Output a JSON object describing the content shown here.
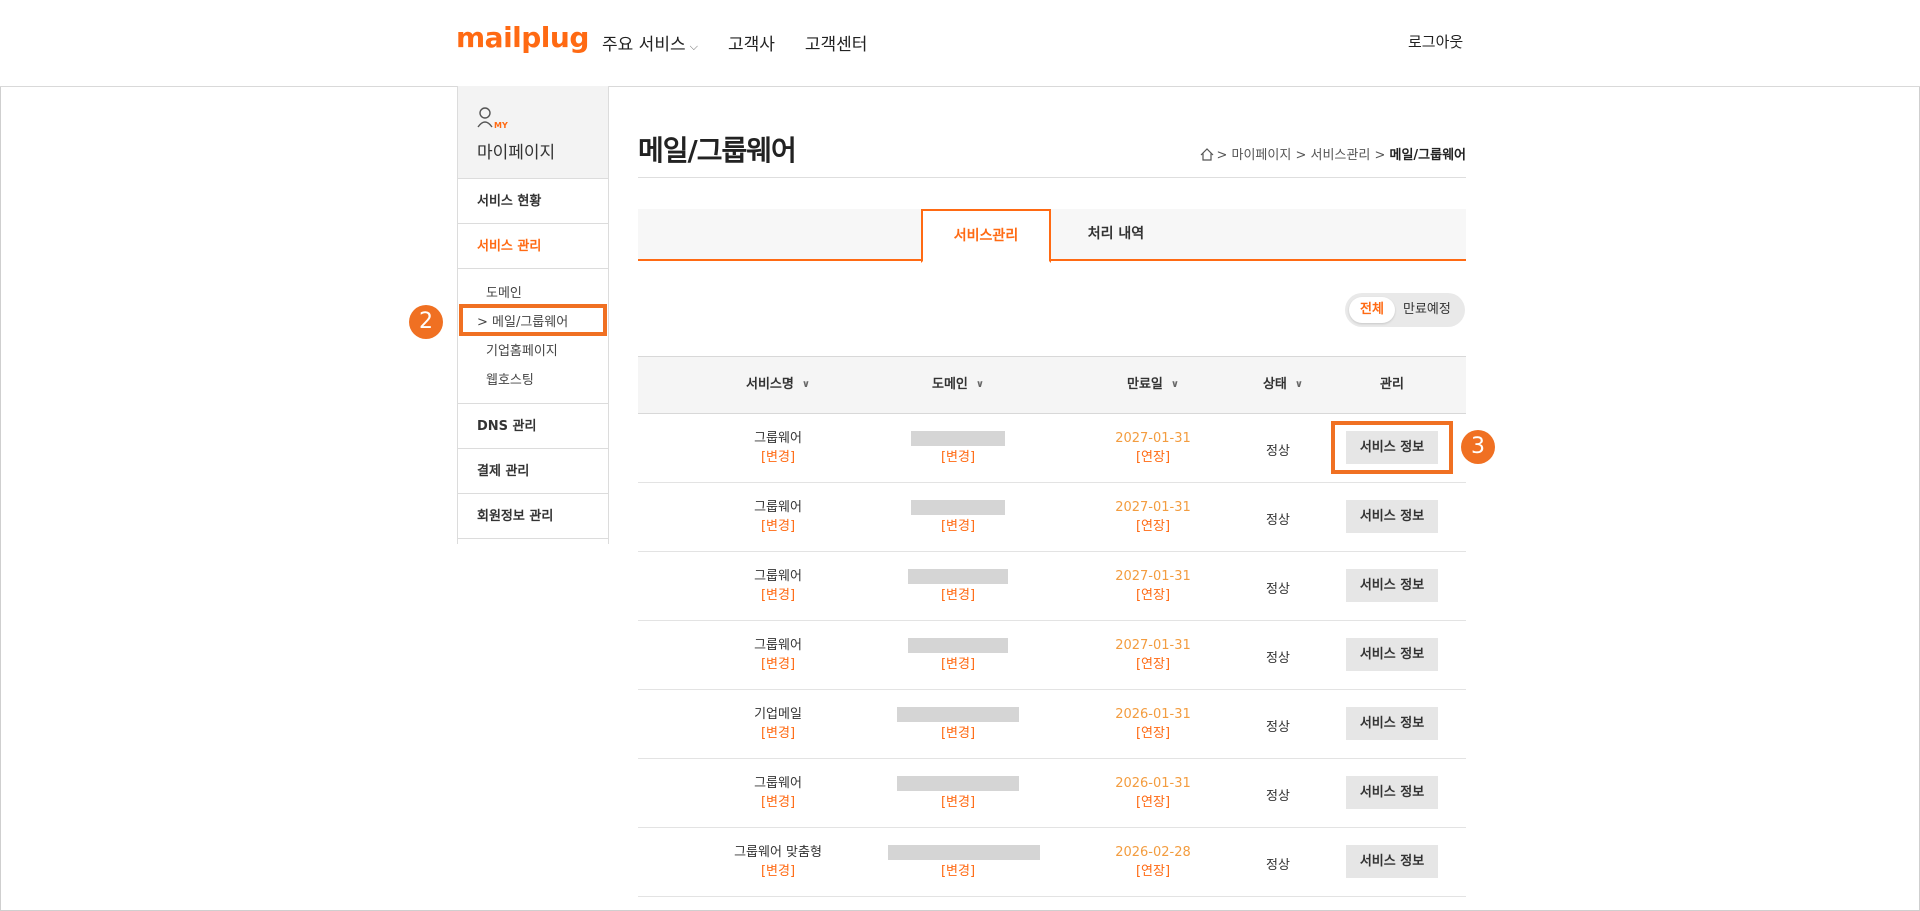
{
  "header": {
    "logo": "mailplug",
    "nav": [
      "주요 서비스",
      "고객사",
      "고객센터"
    ],
    "logout": "로그아웃"
  },
  "sidebar": {
    "my_badge": "MY",
    "title": "마이페이지",
    "items": {
      "service_status": "서비스 현황",
      "service_manage": "서비스 관리",
      "sub": [
        "도메인",
        "메일/그룹웨어",
        "기업홈페이지",
        "웹호스팅"
      ],
      "current_prefix": ">",
      "dns": "DNS 관리",
      "payment": "결제 관리",
      "member": "회원정보 관리"
    }
  },
  "markers": [
    "2",
    "3"
  ],
  "main": {
    "title": "메일/그룹웨어",
    "breadcrumb": [
      ">",
      "마이페이지",
      ">",
      "서비스관리",
      ">",
      "메일/그룹웨어"
    ],
    "tabs": [
      "서비스관리",
      "처리 내역"
    ],
    "filter": {
      "all": "전체",
      "expiring": "만료예정"
    },
    "columns": [
      "서비스명",
      "도메인",
      "만료일",
      "상태",
      "관리"
    ],
    "rows": [
      {
        "service": "그룹웨어",
        "change": "[변경]",
        "domain_change": "[변경]",
        "expiry": "2027-01-31",
        "extend": "[연장]",
        "status": "정상",
        "action": "서비스 정보"
      },
      {
        "service": "그룹웨어",
        "change": "[변경]",
        "domain_change": "[변경]",
        "expiry": "2027-01-31",
        "extend": "[연장]",
        "status": "정상",
        "action": "서비스 정보"
      },
      {
        "service": "그룹웨어",
        "change": "[변경]",
        "domain_change": "[변경]",
        "expiry": "2027-01-31",
        "extend": "[연장]",
        "status": "정상",
        "action": "서비스 정보"
      },
      {
        "service": "그룹웨어",
        "change": "[변경]",
        "domain_change": "[변경]",
        "expiry": "2027-01-31",
        "extend": "[연장]",
        "status": "정상",
        "action": "서비스 정보"
      },
      {
        "service": "기업메일",
        "change": "[변경]",
        "domain_change": "[변경]",
        "expiry": "2026-01-31",
        "extend": "[연장]",
        "status": "정상",
        "action": "서비스 정보"
      },
      {
        "service": "그룹웨어",
        "change": "[변경]",
        "domain_change": "[변경]",
        "expiry": "2026-01-31",
        "extend": "[연장]",
        "status": "정상",
        "action": "서비스 정보"
      },
      {
        "service": "그룹웨어 맞춤형",
        "change": "[변경]",
        "domain_change": "[변경]",
        "expiry": "2026-02-28",
        "extend": "[연장]",
        "status": "정상",
        "action": "서비스 정보"
      }
    ]
  },
  "colors": {
    "accent": "#ff6a13",
    "marker": "#f07022",
    "expiry": "#f39c3f"
  }
}
